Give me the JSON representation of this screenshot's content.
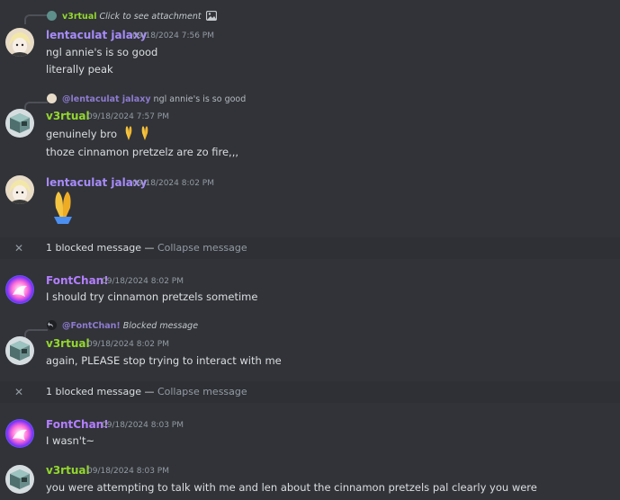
{
  "colors": {
    "background": "#313338",
    "lentaculat": "#a78bfa",
    "v3rtual": "#94d82d",
    "fontchan": "#b47fff",
    "timestamp": "#949ba4"
  },
  "top_reply": {
    "author": "v3rtual",
    "text": "Click to see attachment",
    "icon": "image-icon"
  },
  "messages": [
    {
      "author": "lentaculat jalaxy",
      "timestamp": "09/18/2024 7:56 PM",
      "lines": [
        "ngl annie's is so good",
        "literally peak"
      ]
    },
    {
      "reply_author": "@lentaculat jalaxy",
      "reply_text": "ngl annie's is so good",
      "author": "v3rtual",
      "timestamp": "09/18/2024 7:57 PM",
      "lines": [
        "genuinely bro",
        "thoze cinnamon pretzelz are zo fire,,,"
      ]
    },
    {
      "author": "lentaculat jalaxy",
      "timestamp": "09/18/2024 8:02 PM",
      "emoji": "folded-hands-emoji"
    },
    {
      "author": "FontChan!",
      "timestamp": "09/18/2024 8:02 PM",
      "lines": [
        "I should try cinnamon pretzels sometime"
      ]
    },
    {
      "reply_author": "@FontChan!",
      "reply_text": "Blocked message",
      "author": "v3rtual",
      "timestamp": "09/18/2024 8:02 PM",
      "lines": [
        "again, PLEASE stop trying to interact with me"
      ]
    },
    {
      "author": "FontChan!",
      "timestamp": "09/18/2024 8:03 PM",
      "lines": [
        "I wasn't~"
      ]
    },
    {
      "author": "v3rtual",
      "timestamp": "09/18/2024 8:03 PM",
      "lines": [
        "you were attempting to talk with me and len about the cinnamon pretzels pal clearly you were"
      ]
    }
  ],
  "blocked": {
    "label": "1 blocked message —",
    "action": "Collapse message"
  }
}
